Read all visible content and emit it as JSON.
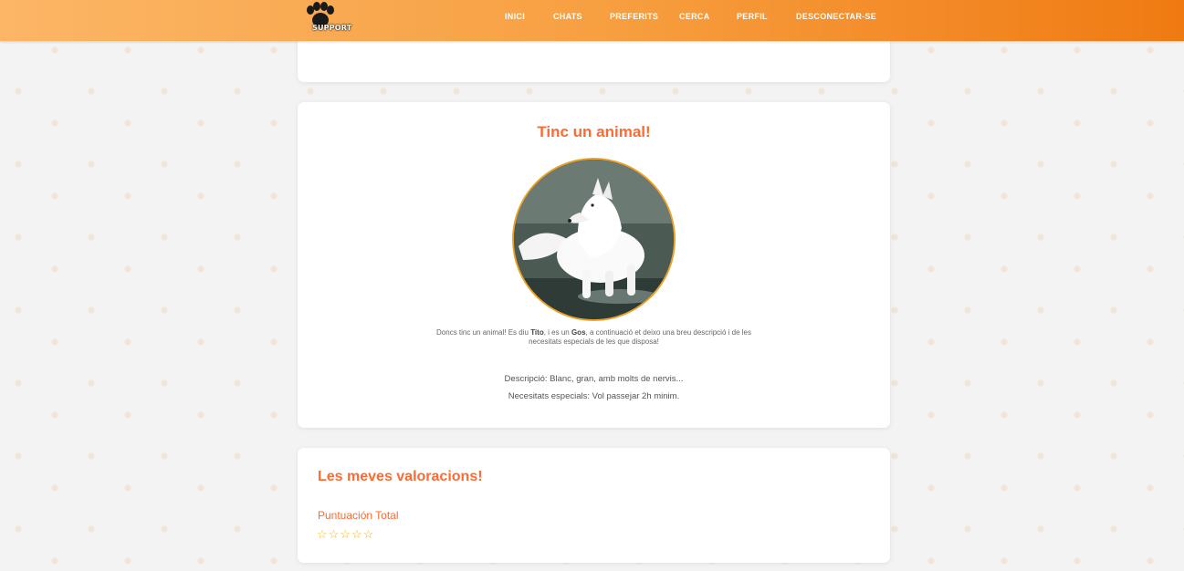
{
  "header": {
    "logo_text": "SUPPORT",
    "nav": [
      {
        "label": "INICI"
      },
      {
        "label": "CHATS"
      },
      {
        "label": "PREFERITS"
      },
      {
        "label": "CERCA"
      },
      {
        "label": "PERFIL"
      },
      {
        "label": "DESCONECTAR-SE"
      }
    ]
  },
  "animal": {
    "title": "Tinc un animal!",
    "photo_icon": "white-dog-photo",
    "intro_a": "Doncs tinc un animal! Es diu ",
    "name": "Tito",
    "intro_b": ", i es un ",
    "species": "Gos",
    "intro_c": ", a continuació et deixo una breu descripció i de les necesitats especials de les que disposa!",
    "description": "Descripció: Blanc, gran, amb molts de nervis...",
    "needs": "Necesitats especials: Vol passejar 2h minim."
  },
  "ratings": {
    "title": "Les meves valoracions!",
    "score_label": "Puntuación Total",
    "stars": [
      "☆",
      "☆",
      "☆",
      "☆",
      "☆"
    ]
  },
  "colors": {
    "accent": "#fb6b33",
    "header_start": "#fcb666",
    "header_end": "#f07a12",
    "star": "#f2b51b",
    "photo_border": "#e9a22a"
  }
}
